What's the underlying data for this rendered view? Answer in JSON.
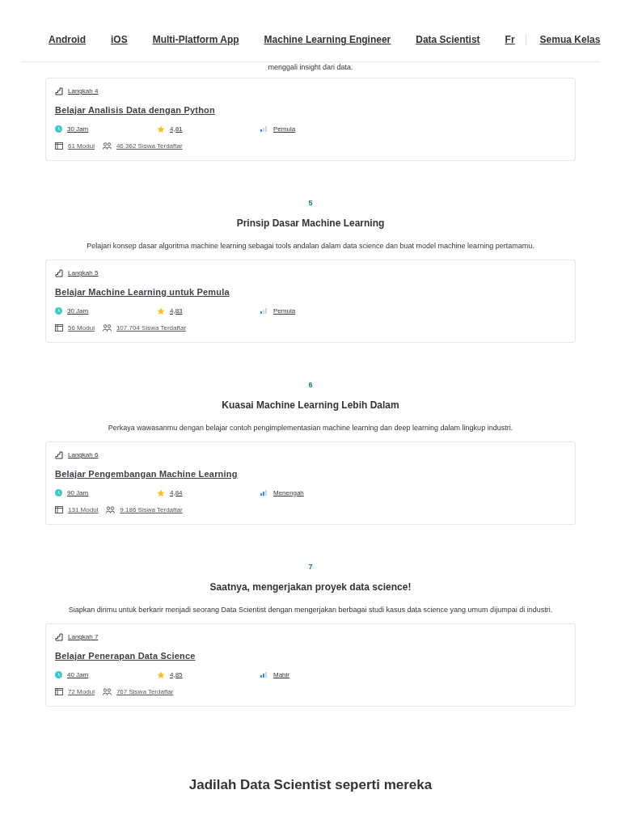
{
  "nav": {
    "items": [
      {
        "label": "Android"
      },
      {
        "label": "iOS"
      },
      {
        "label": "Multi-Platform App"
      },
      {
        "label": "Machine Learning Engineer"
      },
      {
        "label": "Data Scientist"
      },
      {
        "label": "Fr"
      }
    ],
    "all_classes": "Semua Kelas"
  },
  "clipped_description": "menggali insight dari data.",
  "steps": [
    {
      "card": {
        "step_label": "Langkah 4",
        "course_title": "Belajar Analisis Data dengan Python",
        "hours": "30 Jam",
        "rating": "4,81",
        "difficulty": "Pemula",
        "level": 0.34,
        "modules": "61 Modul",
        "students": "46.362 Siswa Terdaftar"
      }
    },
    {
      "number": "5",
      "title": "Prinsip Dasar Machine Learning",
      "description": "Pelajari konsep dasar algoritma machine learning sebagai tools andalan dalam data science dan buat model machine learning pertamamu.",
      "card": {
        "step_label": "Langkah 5",
        "course_title": "Belajar Machine Learning untuk Pemula",
        "hours": "30 Jam",
        "rating": "4,83",
        "difficulty": "Pemula",
        "level": 0.34,
        "modules": "56 Modul",
        "students": "107.704 Siswa Terdaftar"
      }
    },
    {
      "number": "6",
      "title": "Kuasai Machine Learning Lebih Dalam",
      "description": "Perkaya wawasanmu dengan belajar contoh pengimplementasian machine learning dan deep learning dalam lingkup industri.",
      "card": {
        "step_label": "Langkah 6",
        "course_title": "Belajar Pengembangan Machine Learning",
        "hours": "90 Jam",
        "rating": "4,84",
        "difficulty": "Menengah",
        "level": 0.67,
        "modules": "131 Modul",
        "students": "9.186 Siswa Terdaftar"
      }
    },
    {
      "number": "7",
      "title": "Saatnya, mengerjakan proyek data science!",
      "description": "Siapkan dirimu untuk berkarir menjadi seorang Data Scientist dengan mengerjakan berbagai studi kasus data science yang umum dijumpai di industri.",
      "card": {
        "step_label": "Langkah 7",
        "course_title": "Belajar Penerapan Data Science",
        "hours": "40 Jam",
        "rating": "4,85",
        "difficulty": "Mahir",
        "level": 0.67,
        "modules": "72 Modul",
        "students": "767 Siswa Terdaftar"
      }
    }
  ],
  "bottom_heading": "Jadilah Data Scientist seperti mereka"
}
